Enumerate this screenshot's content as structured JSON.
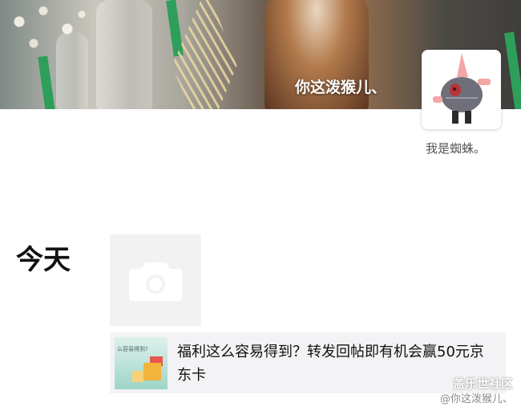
{
  "profile": {
    "username": "你这泼猴儿、",
    "signature": "我是蜘蛛。",
    "avatar_icon": "patrick-star-avatar",
    "cover_image": "cover-photo-bottles-fern"
  },
  "feed": {
    "date_label": "今天",
    "post": {
      "photo_icon": "camera-icon",
      "share_thumb_text": "么容易得到?",
      "share_title": "福利这么容易得到？转发回帖即有机会赢50元京东卡"
    }
  },
  "watermark": {
    "site": "盖乐世社区",
    "user": "@你这泼猴儿、"
  }
}
